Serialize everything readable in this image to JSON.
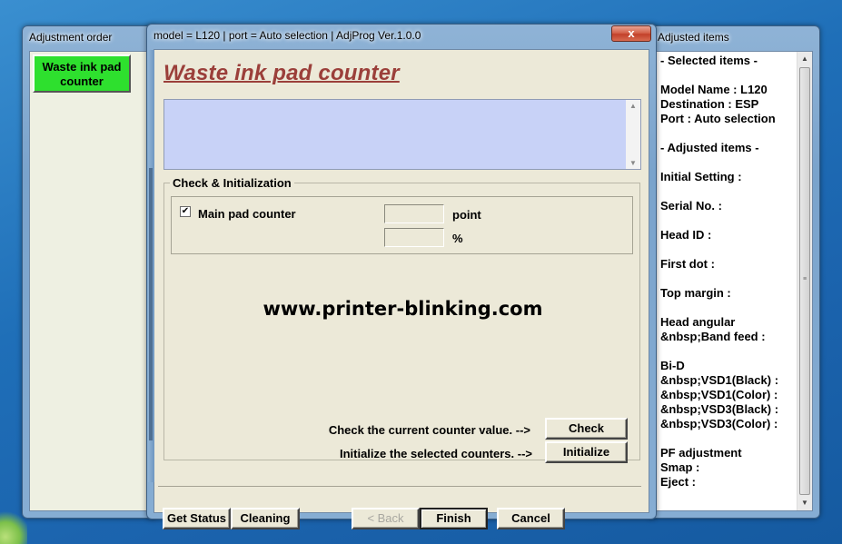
{
  "left_window": {
    "title": "Adjustment order",
    "item_label": "Waste ink pad counter"
  },
  "main_window": {
    "title": "model = L120 | port = Auto selection | AdjProg Ver.1.0.0",
    "close_symbol": "x",
    "heading": "Waste ink pad counter",
    "group_label": "Check & Initialization",
    "checkbox": {
      "label": "Main pad counter",
      "checked": true,
      "mark": "✔"
    },
    "point_value": "",
    "percent_value": "",
    "point_unit": "point",
    "percent_unit": "%",
    "watermark": "www.printer-blinking.com",
    "check_text": "Check the current counter value. -->",
    "check_button": "Check",
    "init_text": "Initialize the selected counters. -->",
    "init_button": "Initialize",
    "footer": {
      "get_status": "Get Status",
      "cleaning": "Cleaning",
      "back": "< Back",
      "finish": "Finish",
      "cancel": "Cancel"
    }
  },
  "right_window": {
    "title": "Adjusted items",
    "lines": [
      "- Selected items -",
      "",
      "Model Name : L120",
      "Destination : ESP",
      "Port : Auto selection",
      "",
      "- Adjusted items -",
      "",
      "Initial Setting :",
      "",
      "Serial No. :",
      "",
      "Head ID :",
      "",
      "First dot :",
      "",
      "Top margin :",
      "",
      "Head angular",
      " Band feed :",
      "",
      "Bi-D",
      " VSD1(Black) :",
      " VSD1(Color) :",
      " VSD3(Black) :",
      " VSD3(Color) :",
      "",
      "PF adjustment",
      "Smap :",
      "Eject :"
    ]
  },
  "colors": {
    "heading": "#9b3f3a",
    "order_button": "#2ee02e",
    "message_box": "#c8d2f7",
    "dialog_face": "#ece9d8"
  }
}
